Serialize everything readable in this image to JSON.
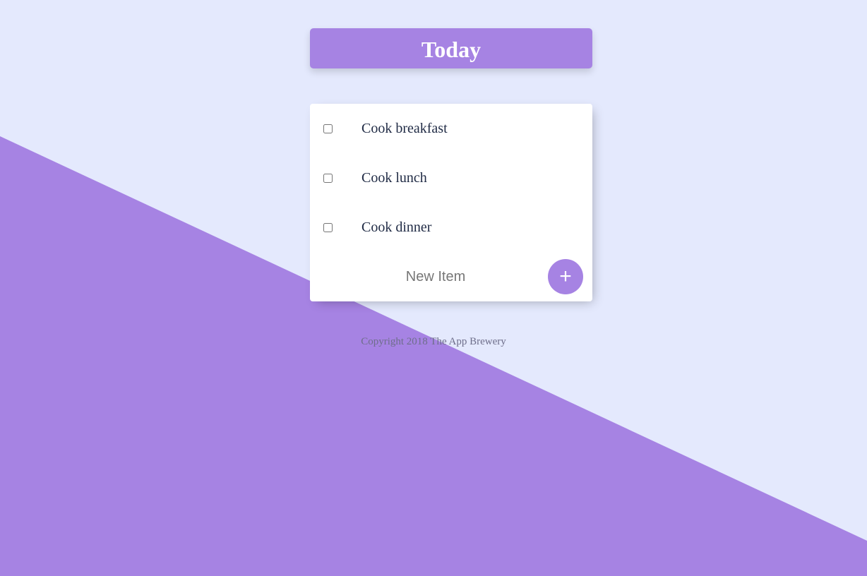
{
  "header": {
    "title": "Today"
  },
  "list": {
    "items": [
      {
        "label": "Cook breakfast",
        "checked": false
      },
      {
        "label": "Cook lunch",
        "checked": false
      },
      {
        "label": "Cook dinner",
        "checked": false
      }
    ]
  },
  "new_item": {
    "placeholder": "New Item",
    "add_label": "+",
    "add_icon": "plus-icon"
  },
  "footer": {
    "text": "Copyright 2018 The App Brewery"
  },
  "colors": {
    "background": "#E4E9FD",
    "accent": "#A683E3",
    "card": "#FFFFFF"
  }
}
